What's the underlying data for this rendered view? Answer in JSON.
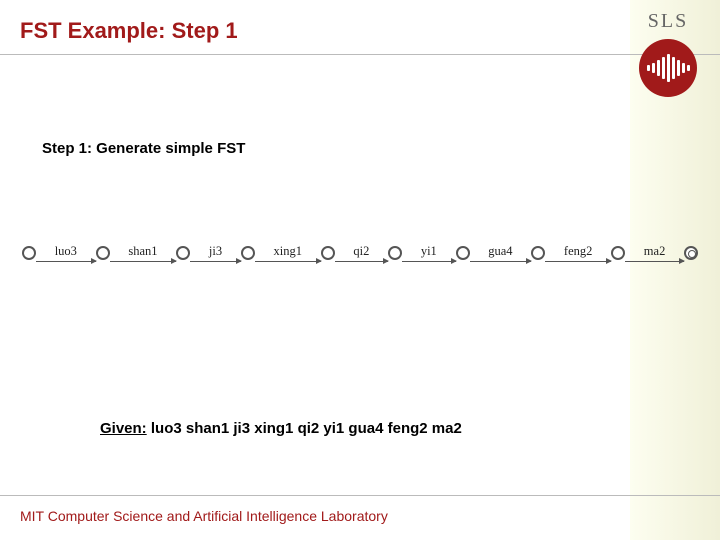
{
  "header": {
    "title": "FST Example: Step 1",
    "logo_text": "SLS"
  },
  "subtitle": "Step 1: Generate simple FST",
  "fst": {
    "arcs": [
      "luo3",
      "shan1",
      "ji3",
      "xing1",
      "qi2",
      "yi1",
      "gua4",
      "feng2",
      "ma2"
    ]
  },
  "given": {
    "label": "Given:",
    "value": "luo3 shan1 ji3 xing1 qi2 yi1 gua4 feng2 ma2"
  },
  "footer": "MIT Computer Science and Artificial Intelligence Laboratory",
  "colors": {
    "accent": "#a11a1a"
  }
}
